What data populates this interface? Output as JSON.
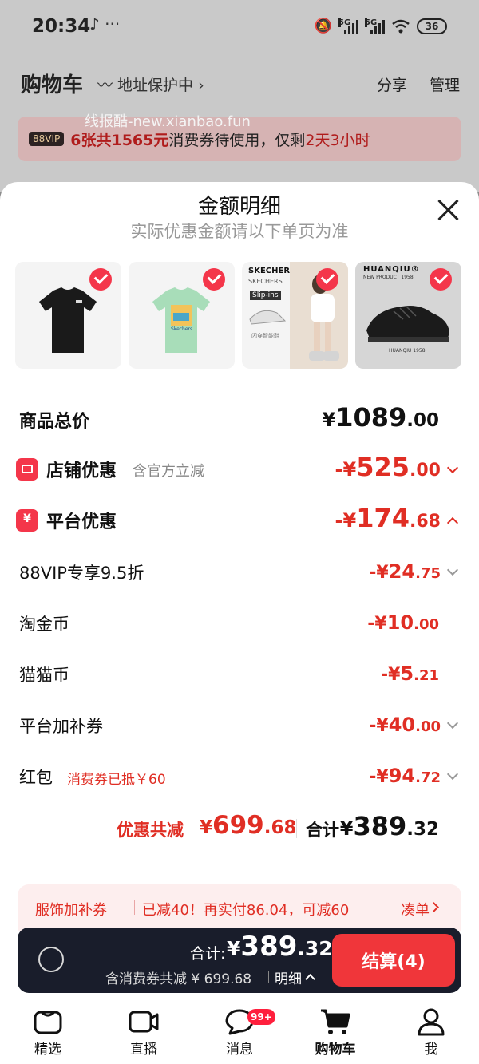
{
  "status_bar": {
    "time": "20:34",
    "extra": "♪ ···",
    "network1": "5G",
    "network2": "5G",
    "battery": "36"
  },
  "cart_header": {
    "title": "购物车",
    "address_protect": "地址保护中 ›",
    "share": "分享",
    "manage": "管理"
  },
  "watermark": "线报酷-new.xianbao.fun",
  "vip_banner": {
    "badge": "88VIP",
    "count": "6张共1565元",
    "middle": "消费券待使用，仅剩",
    "time_left": "2天3小时"
  },
  "sheet": {
    "title": "金额明细",
    "subtitle": "实际优惠金额请以下单页为准"
  },
  "products": [
    {
      "name": "black-tee"
    },
    {
      "name": "green-tee",
      "brand": "Skechers"
    },
    {
      "name": "skechers-sneaker",
      "brand": "SKECHERS",
      "tag": "SKECHERS",
      "tag2": "Slip-ins",
      "foot": "闪穿智能鞋"
    },
    {
      "name": "black-shoe",
      "brand": "HUANQIU®",
      "new": "NEW PRODUCT 1958",
      "foot": "HUANQIU 1958"
    }
  ],
  "rows": {
    "goods_total": {
      "label": "商品总价",
      "yen": "¥",
      "int": "1089",
      "dec": ".00"
    },
    "store": {
      "label": "店铺优惠",
      "note": "含官方立减",
      "sign": "-¥",
      "int": "525",
      "dec": ".00"
    },
    "platform": {
      "label": "平台优惠",
      "sign": "-¥",
      "int": "174",
      "dec": ".68"
    },
    "vip": {
      "label": "88VIP专享9.5折",
      "sign": "-¥",
      "int": "24",
      "dec": ".75"
    },
    "tao_coin": {
      "label": "淘金币",
      "sign": "-¥",
      "int": "10",
      "dec": ".00"
    },
    "cat_coin": {
      "label": "猫猫币",
      "sign": "-¥",
      "int": "5",
      "dec": ".21"
    },
    "platform_coupon": {
      "label": "平台加补券",
      "sign": "-¥",
      "int": "40",
      "dec": ".00"
    },
    "red_packet": {
      "label": "红包",
      "note": "消费券已抵￥60",
      "sign": "-¥",
      "int": "94",
      "dec": ".72"
    }
  },
  "summary": {
    "discount_label": "优惠共减",
    "discount_yen": "¥",
    "discount_int": "699",
    "discount_dec": ".68",
    "total_label": "合计",
    "total_yen": "¥",
    "total_int": "389",
    "total_dec": ".32"
  },
  "promo": {
    "a": "服饰加补券",
    "b": "已减40！再实付86.04，可减60",
    "c": "凑单"
  },
  "checkout": {
    "total_label": "合计:",
    "yen": "¥",
    "int": "389",
    "dec": ".32",
    "sub": "含消费券共减 ¥ 699.68",
    "detail": "明细",
    "button": "结算(4)"
  },
  "tabs": [
    {
      "label": "精选"
    },
    {
      "label": "直播"
    },
    {
      "label": "消息",
      "badge": "99+"
    },
    {
      "label": "购物车"
    },
    {
      "label": "我"
    }
  ],
  "colors": {
    "accent_red": "#e02e24",
    "check_red": "#f4364a",
    "checkout_bg": "#191d2b",
    "button_red": "#f0363a"
  }
}
